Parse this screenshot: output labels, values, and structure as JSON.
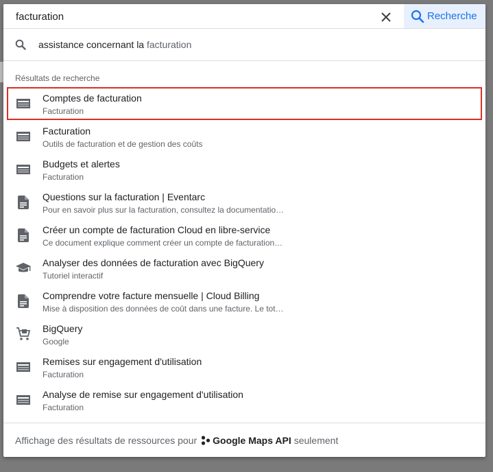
{
  "search": {
    "value": "facturation",
    "button_label": "Recherche"
  },
  "suggestion": {
    "prefix": "assistance concernant la",
    "term": "facturation"
  },
  "results_heading": "Résultats de recherche",
  "results": [
    {
      "title": "Comptes de facturation",
      "subtitle": "Facturation",
      "icon": "billing-card-icon"
    },
    {
      "title": "Facturation",
      "subtitle": "Outils de facturation et de gestion des coûts",
      "icon": "billing-card-icon"
    },
    {
      "title": "Budgets et alertes",
      "subtitle": "Facturation",
      "icon": "billing-card-icon"
    },
    {
      "title": "Questions sur la facturation | Eventarc",
      "subtitle": "Pour en savoir plus sur la facturation, consultez la documentatio…",
      "icon": "document-icon"
    },
    {
      "title": "Créer un compte de facturation Cloud en libre-service",
      "subtitle": "Ce document explique comment créer un compte de facturation…",
      "icon": "document-icon"
    },
    {
      "title": "Analyser des données de facturation avec BigQuery",
      "subtitle": "Tutoriel interactif",
      "icon": "tutorial-cap-icon"
    },
    {
      "title": "Comprendre votre facture mensuelle | Cloud Billing",
      "subtitle": "Mise à disposition des données de coût dans une facture. Le tot…",
      "icon": "document-icon"
    },
    {
      "title": "BigQuery",
      "subtitle": "Google",
      "icon": "marketplace-cart-icon"
    },
    {
      "title": "Remises sur engagement d'utilisation",
      "subtitle": "Facturation",
      "icon": "billing-card-icon"
    },
    {
      "title": "Analyse de remise sur engagement d'utilisation",
      "subtitle": "Facturation",
      "icon": "billing-card-icon"
    }
  ],
  "footer": {
    "prefix": "Affichage des résultats de ressources pour",
    "org_name": "Google Maps API",
    "suffix": "seulement",
    "org_icon": "organization-icon"
  },
  "colors": {
    "accent": "#1a73e8",
    "selection_outline": "#d93025",
    "icon_gray": "#5f6368"
  }
}
